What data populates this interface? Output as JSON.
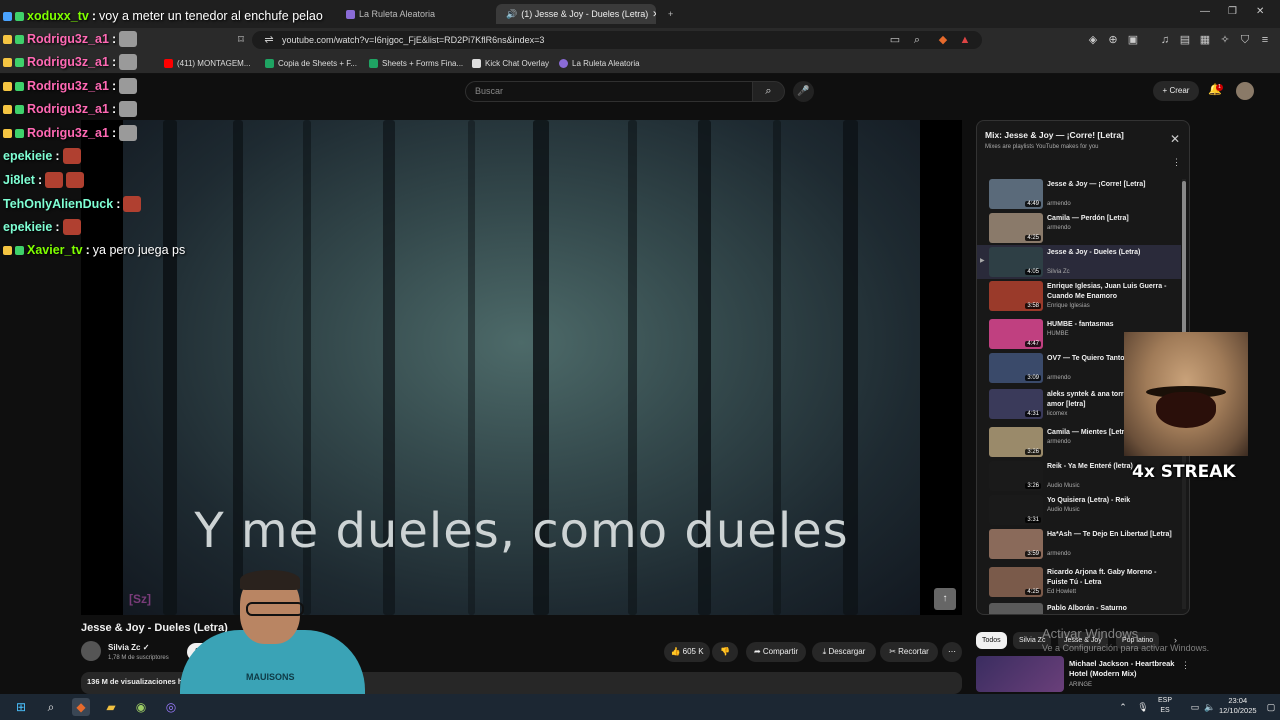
{
  "browser": {
    "tabs": [
      {
        "label": "(1) Jesse & Joy - Dueles (Letra)",
        "active": true
      },
      {
        "label": "La Ruleta Aleatoria",
        "active": false
      }
    ],
    "url": "youtube.com/watch?v=I6njgoc_FjE&list=RD2Pi7KflR6ns&index=3",
    "bookmarks": [
      {
        "label": "(411) MONTAGEM...",
        "color": "#ff0000"
      },
      {
        "label": "Copia de Sheets + F...",
        "color": "#1fa463"
      },
      {
        "label": "Sheets + Forms Fina...",
        "color": "#1fa463"
      },
      {
        "label": "Kick Chat Overlay",
        "color": "#dddddd"
      },
      {
        "label": "La Ruleta Aleatoria",
        "color": "#8a6bd6"
      }
    ]
  },
  "youtube": {
    "search_placeholder": "Buscar",
    "create_label": "Crear",
    "bell_count": "1",
    "video": {
      "lyric": "Y me dueles, como dueles",
      "watermark": "[Sz]",
      "title": "Jesse & Joy - Dueles (Letra)",
      "channel": "Silvia Zc",
      "subscribers": "1,78 M de suscriptores",
      "subscribe_label": "Suscribirme",
      "likes": "605 K",
      "share_label": "Compartir",
      "download_label": "Descargar",
      "clip_label": "Recortar",
      "views": "136 M de visualizaciones  hace"
    },
    "playlist": {
      "title": "Mix: Jesse & Joy — ¡Corre! [Letra]",
      "subtitle": "Mixes are playlists YouTube makes for you",
      "items": [
        {
          "name": "Jesse & Joy — ¡Corre! [Letra]",
          "channel": "armendo",
          "duration": "4:49",
          "color": "#5a6a7a"
        },
        {
          "name": "Camila — Perdón [Letra]",
          "channel": "armendo",
          "duration": "4:25",
          "color": "#8a7a6a"
        },
        {
          "name": "Jesse & Joy - Dueles (Letra)",
          "channel": "Silvia Zc",
          "duration": "4:05",
          "color": "#2e3f45"
        },
        {
          "name": "Enrique Iglesias, Juan Luis Guerra - Cuando Me Enamoro",
          "channel": "Enrique Iglesias",
          "duration": "3:58",
          "color": "#9a3a2a"
        },
        {
          "name": "HUMBE - fantasmas",
          "channel": "HUMBE",
          "duration": "4:47",
          "color": "#c04080"
        },
        {
          "name": "OV7 — Te Quiero Tanto [Letra]",
          "channel": "armendo",
          "duration": "3:09",
          "color": "#3a4a6a"
        },
        {
          "name": "aleks syntek & ana torroja - duele el amor [letra]",
          "channel": "licomex",
          "duration": "4:31",
          "color": "#3a3a5a"
        },
        {
          "name": "Camila — Mientes [Letra]",
          "channel": "armendo",
          "duration": "3:26",
          "color": "#9a8a6a"
        },
        {
          "name": "Reik - Ya Me Enteré (letra)",
          "channel": "Audio Music",
          "duration": "3:26",
          "color": "#1a1a1a"
        },
        {
          "name": "Yo Quisiera (Letra) - Reik",
          "channel": "Audio Music",
          "duration": "3:31",
          "color": "#1a1a1a"
        },
        {
          "name": "Ha*Ash — Te Dejo En Libertad [Letra]",
          "channel": "armendo",
          "duration": "3:59",
          "color": "#8a6a5a"
        },
        {
          "name": "Ricardo Arjona ft. Gaby Moreno - Fuiste Tú - Letra",
          "channel": "Ed Howlett",
          "duration": "4:25",
          "color": "#7a5a4a"
        },
        {
          "name": "Pablo Alborán - Saturno",
          "channel": "",
          "duration": "",
          "color": "#5a5a5a"
        }
      ]
    },
    "chips": [
      "Todos",
      "Silvia Zc",
      "Jesse & Joy",
      "Pop latino"
    ],
    "recommendation": {
      "title": "Michael Jackson - Heartbreak Hotel (Modern Mix)",
      "channel": "ARINGE"
    }
  },
  "windows_watermark": {
    "line1": "Activar Windows",
    "line2": "Ve a Configuración para activar Windows."
  },
  "chat": [
    {
      "user": "xoduxx_tv",
      "message": "voy a meter un tenedor al enchufe pelao",
      "color": "#7fff00"
    },
    {
      "user": "Rodrigu3z_a1",
      "message": "",
      "color": "#ff69b4"
    },
    {
      "user": "Rodrigu3z_a1",
      "message": "",
      "color": "#ff69b4"
    },
    {
      "user": "Rodrigu3z_a1",
      "message": "",
      "color": "#ff69b4"
    },
    {
      "user": "Rodrigu3z_a1",
      "message": "",
      "color": "#ff69b4"
    },
    {
      "user": "Rodrigu3z_a1",
      "message": "",
      "color": "#ff69b4"
    },
    {
      "user": "epekieie",
      "message": "",
      "color": "#7fffd4"
    },
    {
      "user": "Ji8let",
      "message": "",
      "color": "#7fffd4"
    },
    {
      "user": "TehOnlyAlienDuck",
      "message": "",
      "color": "#7fffd4"
    },
    {
      "user": "epekieie",
      "message": "",
      "color": "#7fffd4"
    },
    {
      "user": "Xavier_tv",
      "message": "ya pero juega ps",
      "color": "#7fff00"
    }
  ],
  "streak_overlay": {
    "text": "4x STREAK"
  },
  "webcam": {
    "shirt_text": "MAUISONS"
  },
  "taskbar": {
    "lang_top": "ESP",
    "lang_bottom": "ES",
    "time": "23:04",
    "date": "12/10/2025"
  }
}
